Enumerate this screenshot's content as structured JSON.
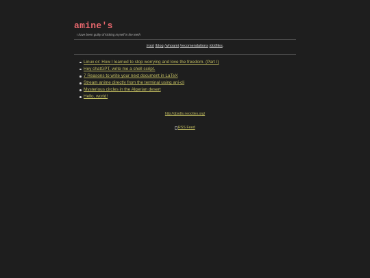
{
  "header": {
    "title": "amine's",
    "tagline": "I have been guilty of kicking myself in the teeth"
  },
  "nav": {
    "items": [
      {
        "label": "/root"
      },
      {
        "label": "/blog"
      },
      {
        "label": "/whoami"
      },
      {
        "label": "/recomendations"
      },
      {
        "label": "/dotfiles"
      }
    ],
    "trailing": "."
  },
  "posts": [
    {
      "title": "Linux or: How I learned to stop worrying and love the freedom. (Part I)"
    },
    {
      "title": "Hey chatGPT, write me a shell script."
    },
    {
      "title": "7 Reasons to write your next document in LaTeX"
    },
    {
      "title": "Stream anime directly from the terminal using ani-cli"
    },
    {
      "title": "Mysterious circles in the Algerian desert"
    },
    {
      "title": "Hello, world!"
    }
  ],
  "footer": {
    "site_url": "http://qbxdts.neocities.org/",
    "rss_label": "RSS Feed"
  },
  "colors": {
    "background": "#1e1e1e",
    "title": "#e8676d",
    "link": "#c2bd60",
    "nav_text": "#d4d4d4"
  }
}
